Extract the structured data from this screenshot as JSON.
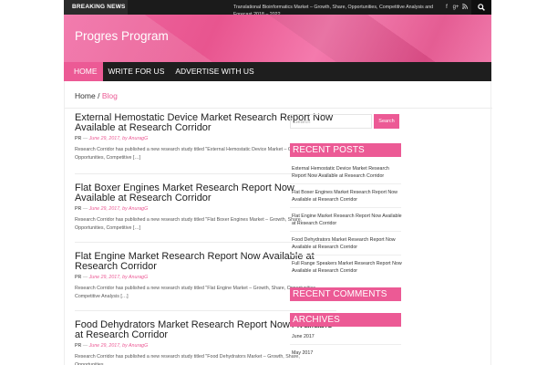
{
  "topbar": {
    "breaking_label": "BREAKING NEWS",
    "ticker_text": "Translational Bioinformatics Market – Growth, Share, Opportunities, Competitive Analysis and Forecast 2018 – 2022",
    "social": [
      "f",
      "g+",
      "rss"
    ],
    "search_icon": "⌕"
  },
  "header": {
    "site_title": "Progres Program"
  },
  "nav": {
    "items": [
      "HOME",
      "WRITE FOR US",
      "ADVERTISE WITH US"
    ]
  },
  "breadcrumb": {
    "home": "Home",
    "sep": "/",
    "current": "Blog"
  },
  "posts": [
    {
      "title": "External Hemostatic Device Market Research Report Now Available at Research Corridor",
      "category": "PR",
      "dash": "—",
      "date": "June 29, 2017",
      "author": ", by AnuragG",
      "excerpt": "Research Corridor has published a new research study titled \"External Hemostatic Device  Market – Growth, Share, Opportunities, Competitive […]"
    },
    {
      "title": "Flat Boxer Engines Market Research Report Now Available at Research Corridor",
      "category": "PR",
      "dash": "—",
      "date": "June 29, 2017",
      "author": ", by AnuragG",
      "excerpt": "Research Corridor has published a new research study titled \"Flat Boxer Engines  Market – Growth, Share, Opportunities, Competitive […]"
    },
    {
      "title": "Flat Engine Market Research Report Now Available at Research Corridor",
      "category": "PR",
      "dash": "—",
      "date": "June 29, 2017",
      "author": ", by AnuragG",
      "excerpt": "Research Corridor has published a new research study titled \"Flat Engine  Market – Growth, Share, Opportunities, Competitive Analysis […]"
    },
    {
      "title": "Food Dehydrators Market Research Report Now Available at Research Corridor",
      "category": "PR",
      "dash": "—",
      "date": "June 29, 2017",
      "author": ", by AnuragG",
      "excerpt": "Research Corridor has published a new research study titled \"Food Dehydrators  Market – Growth, Share, Opportunities,"
    }
  ],
  "sidebar": {
    "search_placeholder": "Search",
    "search_button": "Search",
    "recent_posts_title": "RECENT POSTS",
    "recent_posts": [
      "External Hemostatic Device Market Research Report Now Available at Research Corridor",
      "Flat Boxer Engines Market Research Report Now Available at Research Corridor",
      "Flat Engine Market Research Report Now Available at Research Corridor",
      "Food Dehydrators Market Research Report Now Available at Research Corridor",
      "Full Range Speakers Market Research Report Now Available at Research Corridor"
    ],
    "recent_comments_title": "RECENT COMMENTS",
    "archives_title": "ARCHIVES",
    "archives": [
      "June 2017",
      "May 2017"
    ]
  },
  "colors": {
    "accent": "#ec5a95",
    "dark": "#1e1e1e"
  }
}
